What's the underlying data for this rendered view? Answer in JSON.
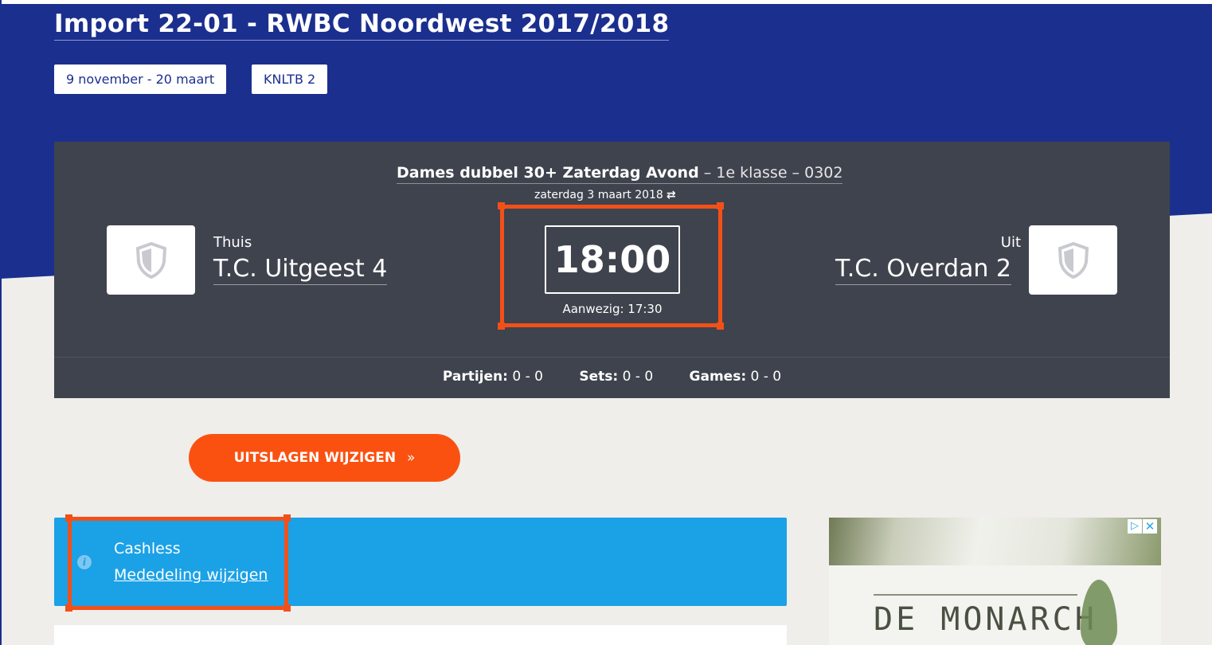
{
  "header": {
    "title": "Import 22-01 - RWBC Noordwest 2017/2018",
    "tags": [
      "9 november - 20 maart",
      "KNLTB 2"
    ]
  },
  "match": {
    "competition": "Dames dubbel 30+ Zaterdag Avond",
    "separator1": " – ",
    "class": "1e klasse",
    "separator2": " – ",
    "code": "0302",
    "date": "zaterdag 3 maart 2018",
    "swap_icon": "⇄",
    "home": {
      "label": "Thuis",
      "name": "T.C. Uitgeest 4"
    },
    "away": {
      "label": "Uit",
      "name": "T.C. Overdan 2"
    },
    "time": "18:00",
    "present": "Aanwezig: 17:30",
    "scores": [
      {
        "label": "Partijen:",
        "value": "0 - 0"
      },
      {
        "label": "Sets:",
        "value": "0 - 0"
      },
      {
        "label": "Games:",
        "value": "0 - 0"
      }
    ]
  },
  "cta": {
    "label": "UITSLAGEN WIJZIGEN",
    "arrow": "»"
  },
  "notice": {
    "icon": "i",
    "title": "Cashless",
    "link": "Mededeling wijzigen"
  },
  "ad": {
    "brand": "DE MONARCH",
    "play_icon": "▷",
    "close_icon": "✕"
  },
  "colors": {
    "header_blue": "#1b2f8f",
    "card": "#3f434d",
    "accent_orange": "#fa5111",
    "highlight": "#f25019",
    "notice_blue": "#1ba1e6",
    "background": "#efeeeb"
  }
}
